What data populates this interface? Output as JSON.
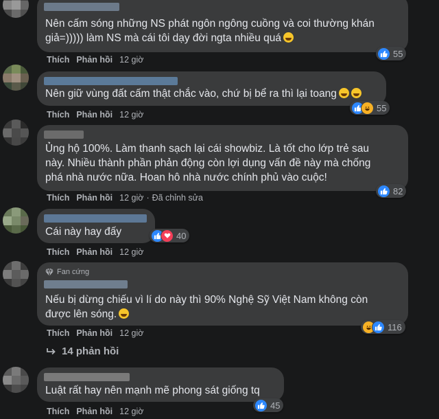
{
  "actions": {
    "like": "Thích",
    "reply": "Phản hồi",
    "dot": "·"
  },
  "comments": [
    {
      "text_lines": [
        "Nên cấm sóng những NS phát ngôn ngông cuồng và coi thường khán",
        "giả=))))) làm NS mà cái tôi dạy đời ngta nhiều quá"
      ],
      "emoji": "rofl",
      "time": "12 giờ",
      "reactions": [
        "like"
      ],
      "count": "55"
    },
    {
      "text_lines": [
        "Nên giữ vùng đất cấm thật chắc vào, chứ bị bể ra thì lại toang"
      ],
      "emoji": "laugh",
      "time": "12 giờ",
      "reactions": [
        "like",
        "haha"
      ],
      "count": "55"
    },
    {
      "text_lines": [
        "Ủng hộ 100%. Làm thanh sạch lại cái showbiz. Là tốt cho lớp trẻ sau",
        "này. Nhiều thành phần phản động còn lợi dụng vấn đề này mà chống",
        "phá nhà nước nữa. Hoan hô nhà nước chính phủ vào cuộc!"
      ],
      "time": "12 giờ",
      "edited": "Đã chỉnh sửa",
      "reactions": [
        "like"
      ],
      "count": "82"
    },
    {
      "text_lines": [
        "Cái này hay đấy"
      ],
      "time": "12 giờ",
      "reactions": [
        "like",
        "love"
      ],
      "count": "40"
    },
    {
      "badge": "Fan cứng",
      "text_lines": [
        "Nếu bị dừng chiếu vì lí do này thì 90% Nghệ Sỹ Việt Nam không còn",
        "được lên sóng."
      ],
      "emoji": "sweat",
      "time": "12 giờ",
      "reactions": [
        "haha",
        "like"
      ],
      "count": "116"
    },
    {
      "text_lines": [
        "Luật rất hay nên mạnh mẽ phong sát giống tq"
      ],
      "time": "12 giờ",
      "reactions": [
        "like"
      ],
      "count": "45"
    }
  ],
  "replies_label": "14 phản hồi",
  "colors": {
    "bg": "#18191a",
    "bubble": "#3a3b3c",
    "text": "#e4e6eb",
    "muted": "#b0b3b8",
    "like": "#2d88ff",
    "haha": "#f7b125",
    "love": "#f33e58"
  }
}
